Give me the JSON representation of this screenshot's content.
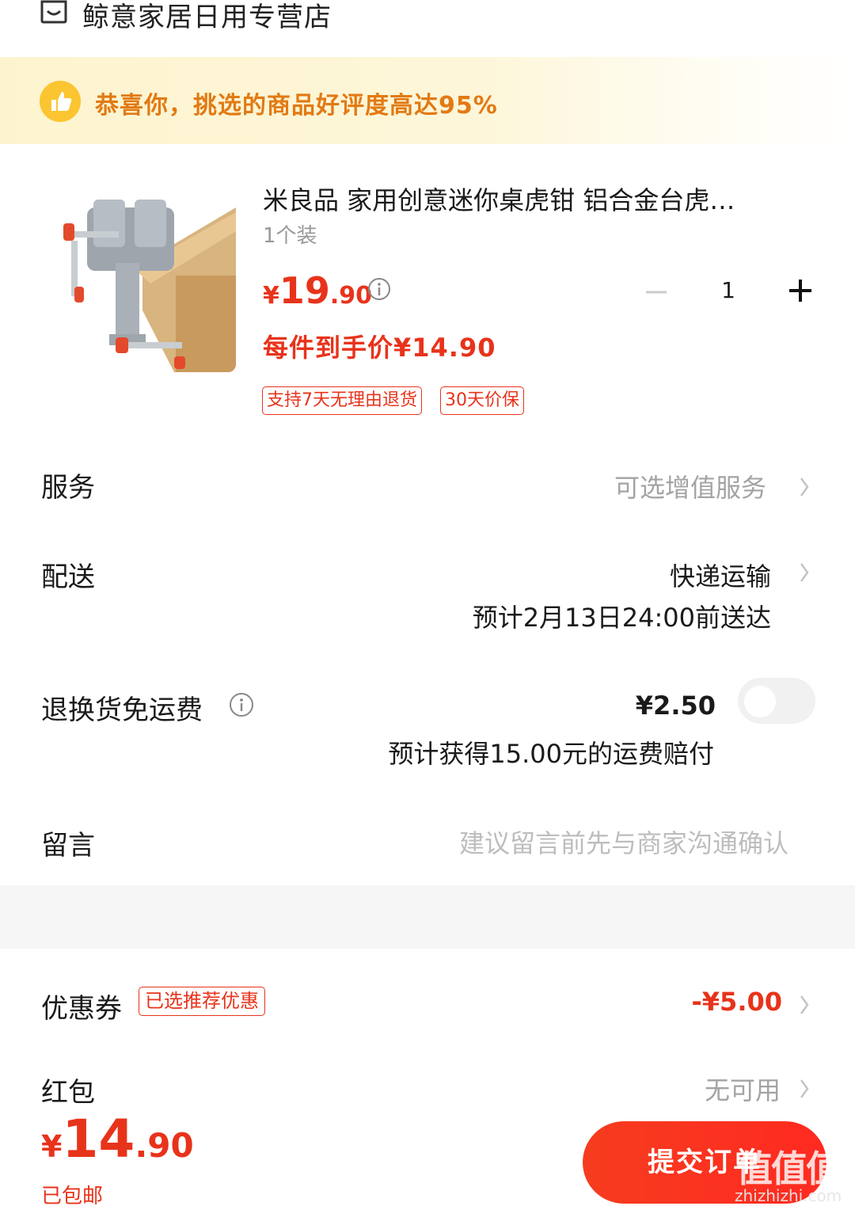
{
  "store": {
    "name": "鲸意家居日用专营店"
  },
  "banner": {
    "text": "恭喜你，挑选的商品好评度高达95%"
  },
  "product": {
    "title": "米良品 家用创意迷你桌虎钳 铝合金台虎…",
    "spec": "1个装",
    "price_symbol": "¥",
    "price_int": "19",
    "price_dec": ".90",
    "final_price": "每件到手价¥14.90",
    "quantity": "1",
    "tags": [
      "支持7天无理由退货",
      "30天价保"
    ]
  },
  "service": {
    "label": "服务",
    "value": "可选增值服务"
  },
  "delivery": {
    "label": "配送",
    "value": "快递运输",
    "eta": "预计2月13日24:00前送达"
  },
  "return_shipping": {
    "label": "退换货免运费",
    "price": "¥2.50",
    "compensation": "预计获得15.00元的运费赔付",
    "enabled": false
  },
  "message": {
    "label": "留言",
    "placeholder": "建议留言前先与商家沟通确认"
  },
  "coupon": {
    "label": "优惠券",
    "tag": "已选推荐优惠",
    "value": "-¥5.00"
  },
  "red_packet": {
    "label": "红包",
    "value": "无可用"
  },
  "footer": {
    "total_symbol": "¥",
    "total_int": "14",
    "total_dec": ".90",
    "shipping_note": "已包邮",
    "submit_label": "提交订单"
  },
  "watermark": {
    "logo_text": "值值值",
    "url": "zhizhizhi.com"
  },
  "colors": {
    "accent": "#e8331b",
    "banner_text": "#e27a14",
    "banner_bg": "#fdf4cf"
  }
}
